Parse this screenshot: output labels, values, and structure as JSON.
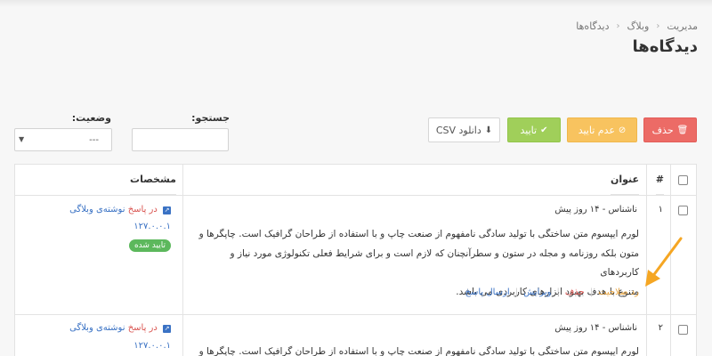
{
  "breadcrumb": [
    "مدیریت",
    "وبلاگ",
    "دیدگاه‌ها"
  ],
  "page_title": "دیدگاه‌ها",
  "toolbar": {
    "delete_label": "حذف",
    "unapprove_label": "عدم تایید",
    "approve_label": "تایید",
    "csv_label": "دانلود CSV"
  },
  "filters": {
    "search_label": "جستجو:",
    "search_value": "",
    "status_label": "وضعیت:",
    "status_value": "---"
  },
  "table": {
    "col_num": "#",
    "col_title": "عنوان",
    "col_details": "مشخصات"
  },
  "rows": [
    {
      "num": "۱",
      "author": "ناشناس - ۱۴ روز پیش",
      "lines": [
        "لورم ایپسوم متن ساختگی با تولید سادگی نامفهوم از صنعت چاپ و با استفاده از طراحان گرافیک است. چاپگرها و",
        "متون بلکه روزنامه و مجله در ستون و سطرآنچنان که لازم است و برای شرایط فعلی تکنولوژی مورد نیاز و کاربردهای",
        "متنوع با هدف بهبود ابزارهای کاربردی می باشد."
      ],
      "actions": {
        "disapprove": "رد صلاحیت",
        "delete": "حذف",
        "edit": "ویرایش",
        "reply": "ارسال پاسخ"
      },
      "link_pre": "در پاسخ",
      "link_post": "نوشته‌ی وبلاگی",
      "ip": "۱۲۷.۰.۰.۱",
      "status": "تایید شده"
    },
    {
      "num": "۲",
      "author": "ناشناس - ۱۴ روز پیش",
      "lines": [
        "لورم ایپسوم متن ساختگی با تولید سادگی نامفهوم از صنعت چاپ و با استفاده از طراحان گرافیک است. چاپگرها و"
      ],
      "link_pre": "در پاسخ",
      "link_post": "نوشته‌ی وبلاگی",
      "ip": "۱۲۷.۰.۰.۱"
    }
  ],
  "colors": {
    "delete": "#ec6b66",
    "unapprove": "#f8c35f",
    "approve": "#a0cf5a",
    "link": "#3a72c4",
    "badge": "#5cb85c",
    "annotation_arrow": "#f5a623"
  }
}
